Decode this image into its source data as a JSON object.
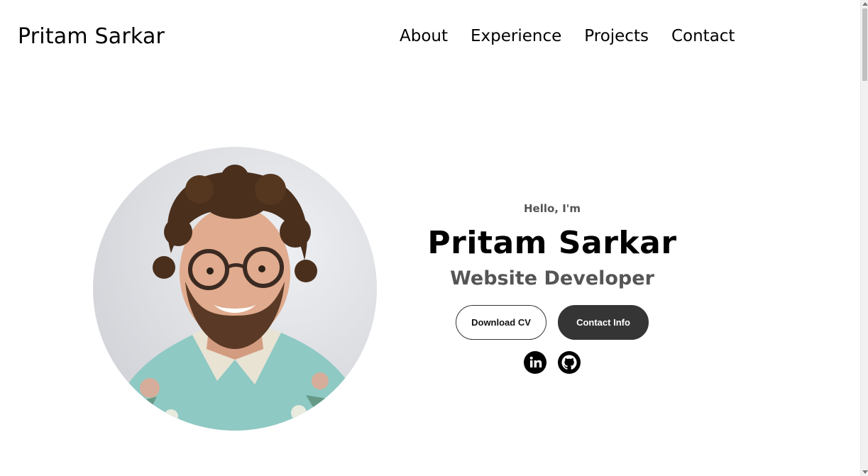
{
  "header": {
    "logo": "Pritam Sarkar",
    "nav": [
      "About",
      "Experience",
      "Projects",
      "Contact"
    ]
  },
  "hero": {
    "greeting": "Hello, I'm",
    "name": "Pritam Sarkar",
    "role": "Website Developer",
    "buttons": {
      "download_cv": "Download CV",
      "contact_info": "Contact Info"
    },
    "socials": [
      "linkedin-icon",
      "github-icon"
    ]
  },
  "colors": {
    "text": "#000000",
    "muted": "#555555",
    "button_dark": "#353535",
    "photo_bg": "#e2e3e7",
    "shirt": "#8ec9c3"
  }
}
